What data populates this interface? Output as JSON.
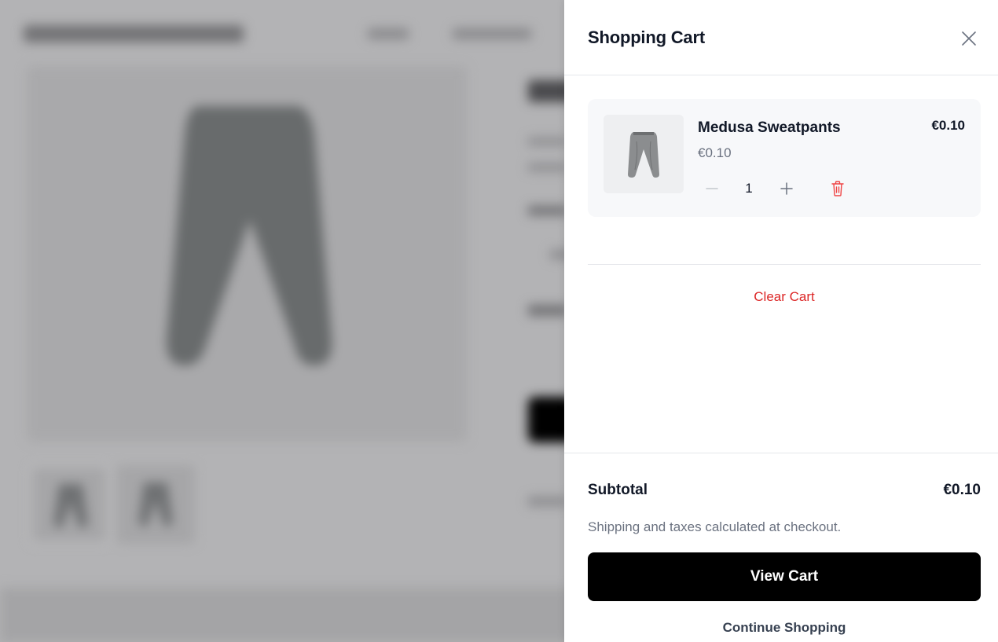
{
  "cart": {
    "title": "Shopping Cart",
    "items": [
      {
        "name": "Medusa Sweatpants",
        "unit_price": "€0.10",
        "total_price": "€0.10",
        "quantity": "1"
      }
    ],
    "clear_label": "Clear Cart",
    "subtotal_label": "Subtotal",
    "subtotal_value": "€0.10",
    "shipping_note": "Shipping and taxes calculated at checkout.",
    "view_cart_label": "View Cart",
    "continue_label": "Continue Shopping"
  },
  "colors": {
    "danger": "#dc2626",
    "primary_button": "#000000",
    "muted_text": "#6b7280",
    "item_background": "#f7f8fa"
  },
  "icons": {
    "close": "close-icon",
    "minus": "minus-icon",
    "plus": "plus-icon",
    "delete": "trash-icon",
    "product": "sweatpants-image"
  }
}
